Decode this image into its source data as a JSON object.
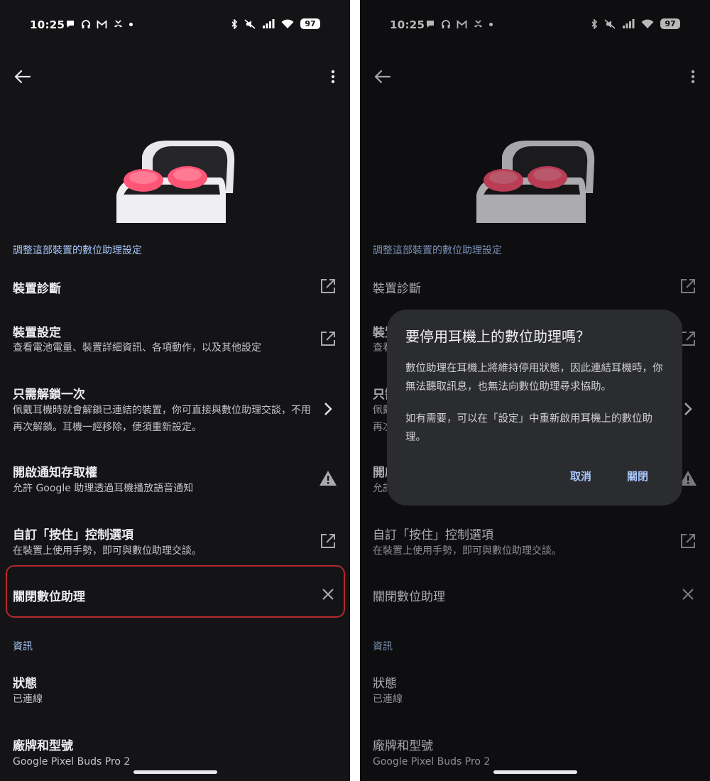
{
  "status_bar": {
    "time": "10:25",
    "battery": "97"
  },
  "hero": {
    "image": "pixel-buds-case-image"
  },
  "sections": {
    "assistant_header": "調整這部裝置的數位助理設定",
    "info_header": "資訊"
  },
  "items": {
    "diagnostics": {
      "title": "裝置診斷"
    },
    "settings": {
      "title": "裝置設定",
      "subtitle": "查看電池電量、裝置詳細資訊、各項動作，以及其他設定"
    },
    "unlock": {
      "title": "只需解鎖一次",
      "subtitle": "佩戴耳機時就會解鎖已連結的裝置，你可直接與數位助理交談，不用再次解鎖。耳機一經移除，便須重新設定。"
    },
    "notifications": {
      "title": "開啟通知存取權",
      "subtitle": "允許 Google 助理透過耳機播放語音通知"
    },
    "hold_controls": {
      "title": "自訂「按住」控制選項",
      "subtitle": "在裝置上使用手勢，即可與數位助理交談。"
    },
    "disable_assistant": {
      "title": "關閉數位助理"
    },
    "status": {
      "title": "狀態",
      "subtitle": "已連線"
    },
    "model": {
      "title": "廠牌和型號",
      "subtitle": "Google Pixel Buds Pro 2"
    }
  },
  "dialog": {
    "title": "要停用耳機上的數位助理嗎？",
    "body1": "數位助理在耳機上將維持停用狀態，因此連結耳機時，你無法聽取訊息，也無法向數位助理尋求協助。",
    "body2": "如有需要，可以在「設定」中重新啟用耳機上的數位助理。",
    "cancel": "取消",
    "confirm": "關閉"
  },
  "colors": {
    "background": "#141417",
    "accent": "#a8c7fa",
    "highlight_border": "#b3282d",
    "dialog": "#2b2c30"
  }
}
